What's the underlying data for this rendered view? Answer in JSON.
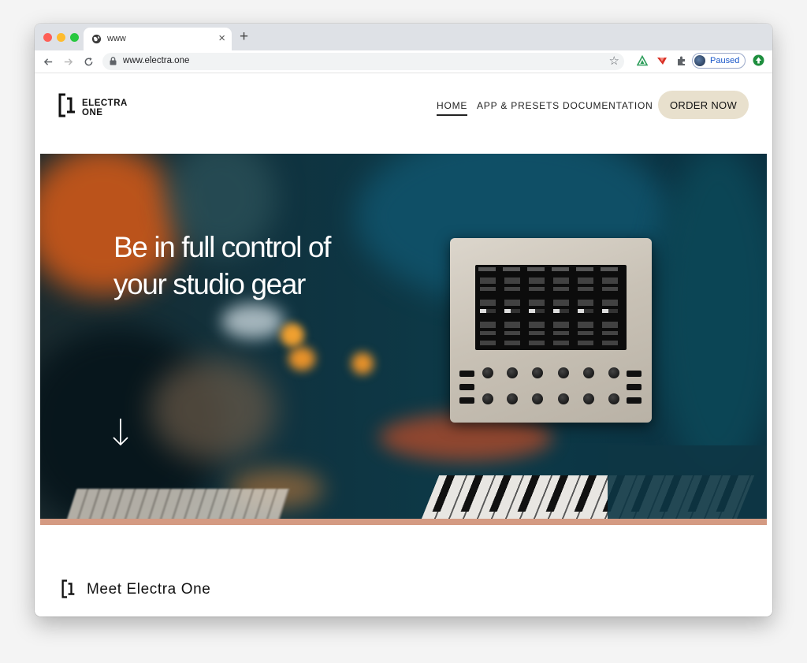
{
  "browser": {
    "tab_title": "www",
    "tab_close": "×",
    "new_tab": "+",
    "url": "www.electra.one",
    "star": "☆",
    "profile_status": "Paused"
  },
  "site": {
    "logo_line1": "ELECTRA",
    "logo_line2": "ONE",
    "nav": [
      {
        "label": "HOME",
        "active": true
      },
      {
        "label": "APP & PRESETS",
        "active": false
      },
      {
        "label": "DOCUMENTATION",
        "active": false
      }
    ],
    "order_button": "ORDER NOW"
  },
  "hero": {
    "title_line1": "Be in full control of",
    "title_line2": "your studio gear"
  },
  "section": {
    "heading": "Meet Electra One"
  }
}
